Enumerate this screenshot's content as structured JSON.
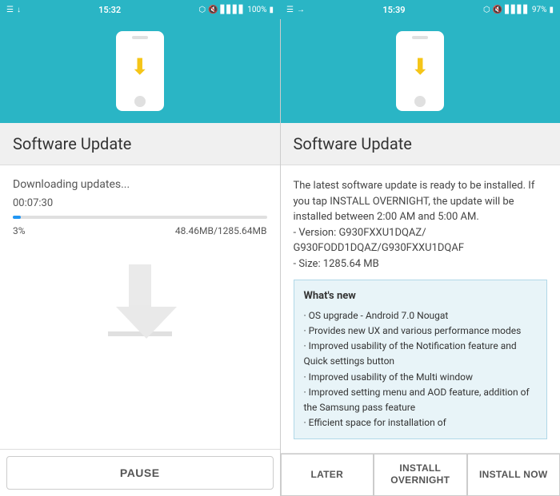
{
  "statusbar_left": {
    "left_icons": "☰ ↓",
    "time": "15:32",
    "right_icons": "🔵 🔕 📶 100% 🔋"
  },
  "statusbar_right": {
    "left_icons": "☰ →",
    "time": "15:39",
    "right_icons": "🔵 🔕 📶 97% 🔋"
  },
  "panel_left": {
    "title": "Software Update",
    "status_text": "Downloading updates...",
    "timer": "00:07:30",
    "progress_percent": 3,
    "progress_label": "3%",
    "size_label": "48.46MB/1285.64MB",
    "pause_button": "PAUSE"
  },
  "panel_right": {
    "title": "Software Update",
    "description": "The latest software update is ready to be installed. If you tap INSTALL OVERNIGHT, the update will be installed between 2:00 AM and 5:00 AM.",
    "version_line1": "- Version: G930FXXU1DQAZ/",
    "version_line2": "G930FODD1DQAZ/G930FXXU1DQAF",
    "size_info": "- Size: 1285.64 MB",
    "whats_new": {
      "title": "What's new",
      "items": [
        "· OS upgrade - Android 7.0 Nougat",
        "· Provides new UX and various performance modes",
        "· Improved usability of the Notification feature and Quick settings button",
        "· Improved usability of the Multi window",
        "· Improved setting menu and AOD feature, addition of the Samsung pass feature",
        "· Efficient space for installation of"
      ]
    },
    "btn_later": "LATER",
    "btn_overnight": "INSTALL OVERNIGHT",
    "btn_now": "INSTALL NOW"
  }
}
